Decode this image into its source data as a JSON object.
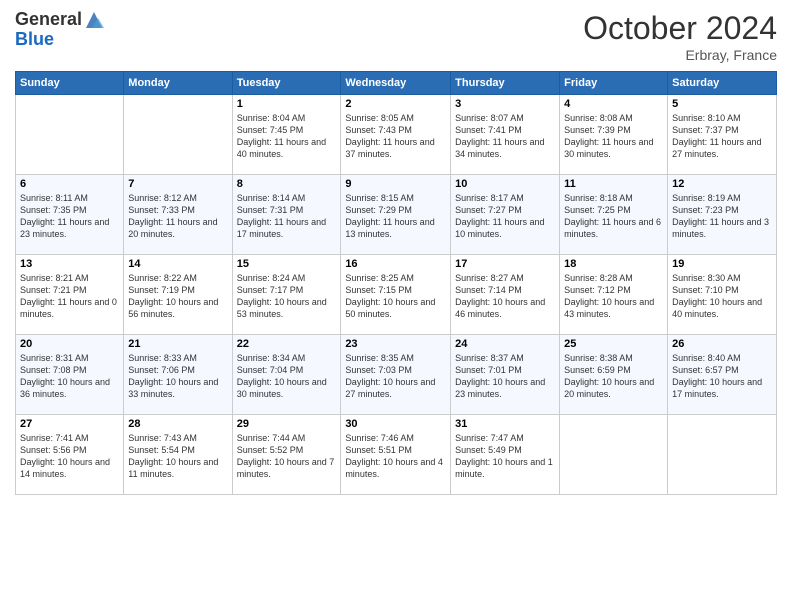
{
  "logo": {
    "general": "General",
    "blue": "Blue"
  },
  "header": {
    "month": "October 2024",
    "location": "Erbray, France"
  },
  "weekdays": [
    "Sunday",
    "Monday",
    "Tuesday",
    "Wednesday",
    "Thursday",
    "Friday",
    "Saturday"
  ],
  "weeks": [
    [
      {
        "day": "",
        "info": ""
      },
      {
        "day": "",
        "info": ""
      },
      {
        "day": "1",
        "info": "Sunrise: 8:04 AM\nSunset: 7:45 PM\nDaylight: 11 hours and 40 minutes."
      },
      {
        "day": "2",
        "info": "Sunrise: 8:05 AM\nSunset: 7:43 PM\nDaylight: 11 hours and 37 minutes."
      },
      {
        "day": "3",
        "info": "Sunrise: 8:07 AM\nSunset: 7:41 PM\nDaylight: 11 hours and 34 minutes."
      },
      {
        "day": "4",
        "info": "Sunrise: 8:08 AM\nSunset: 7:39 PM\nDaylight: 11 hours and 30 minutes."
      },
      {
        "day": "5",
        "info": "Sunrise: 8:10 AM\nSunset: 7:37 PM\nDaylight: 11 hours and 27 minutes."
      }
    ],
    [
      {
        "day": "6",
        "info": "Sunrise: 8:11 AM\nSunset: 7:35 PM\nDaylight: 11 hours and 23 minutes."
      },
      {
        "day": "7",
        "info": "Sunrise: 8:12 AM\nSunset: 7:33 PM\nDaylight: 11 hours and 20 minutes."
      },
      {
        "day": "8",
        "info": "Sunrise: 8:14 AM\nSunset: 7:31 PM\nDaylight: 11 hours and 17 minutes."
      },
      {
        "day": "9",
        "info": "Sunrise: 8:15 AM\nSunset: 7:29 PM\nDaylight: 11 hours and 13 minutes."
      },
      {
        "day": "10",
        "info": "Sunrise: 8:17 AM\nSunset: 7:27 PM\nDaylight: 11 hours and 10 minutes."
      },
      {
        "day": "11",
        "info": "Sunrise: 8:18 AM\nSunset: 7:25 PM\nDaylight: 11 hours and 6 minutes."
      },
      {
        "day": "12",
        "info": "Sunrise: 8:19 AM\nSunset: 7:23 PM\nDaylight: 11 hours and 3 minutes."
      }
    ],
    [
      {
        "day": "13",
        "info": "Sunrise: 8:21 AM\nSunset: 7:21 PM\nDaylight: 11 hours and 0 minutes."
      },
      {
        "day": "14",
        "info": "Sunrise: 8:22 AM\nSunset: 7:19 PM\nDaylight: 10 hours and 56 minutes."
      },
      {
        "day": "15",
        "info": "Sunrise: 8:24 AM\nSunset: 7:17 PM\nDaylight: 10 hours and 53 minutes."
      },
      {
        "day": "16",
        "info": "Sunrise: 8:25 AM\nSunset: 7:15 PM\nDaylight: 10 hours and 50 minutes."
      },
      {
        "day": "17",
        "info": "Sunrise: 8:27 AM\nSunset: 7:14 PM\nDaylight: 10 hours and 46 minutes."
      },
      {
        "day": "18",
        "info": "Sunrise: 8:28 AM\nSunset: 7:12 PM\nDaylight: 10 hours and 43 minutes."
      },
      {
        "day": "19",
        "info": "Sunrise: 8:30 AM\nSunset: 7:10 PM\nDaylight: 10 hours and 40 minutes."
      }
    ],
    [
      {
        "day": "20",
        "info": "Sunrise: 8:31 AM\nSunset: 7:08 PM\nDaylight: 10 hours and 36 minutes."
      },
      {
        "day": "21",
        "info": "Sunrise: 8:33 AM\nSunset: 7:06 PM\nDaylight: 10 hours and 33 minutes."
      },
      {
        "day": "22",
        "info": "Sunrise: 8:34 AM\nSunset: 7:04 PM\nDaylight: 10 hours and 30 minutes."
      },
      {
        "day": "23",
        "info": "Sunrise: 8:35 AM\nSunset: 7:03 PM\nDaylight: 10 hours and 27 minutes."
      },
      {
        "day": "24",
        "info": "Sunrise: 8:37 AM\nSunset: 7:01 PM\nDaylight: 10 hours and 23 minutes."
      },
      {
        "day": "25",
        "info": "Sunrise: 8:38 AM\nSunset: 6:59 PM\nDaylight: 10 hours and 20 minutes."
      },
      {
        "day": "26",
        "info": "Sunrise: 8:40 AM\nSunset: 6:57 PM\nDaylight: 10 hours and 17 minutes."
      }
    ],
    [
      {
        "day": "27",
        "info": "Sunrise: 7:41 AM\nSunset: 5:56 PM\nDaylight: 10 hours and 14 minutes."
      },
      {
        "day": "28",
        "info": "Sunrise: 7:43 AM\nSunset: 5:54 PM\nDaylight: 10 hours and 11 minutes."
      },
      {
        "day": "29",
        "info": "Sunrise: 7:44 AM\nSunset: 5:52 PM\nDaylight: 10 hours and 7 minutes."
      },
      {
        "day": "30",
        "info": "Sunrise: 7:46 AM\nSunset: 5:51 PM\nDaylight: 10 hours and 4 minutes."
      },
      {
        "day": "31",
        "info": "Sunrise: 7:47 AM\nSunset: 5:49 PM\nDaylight: 10 hours and 1 minute."
      },
      {
        "day": "",
        "info": ""
      },
      {
        "day": "",
        "info": ""
      }
    ]
  ]
}
